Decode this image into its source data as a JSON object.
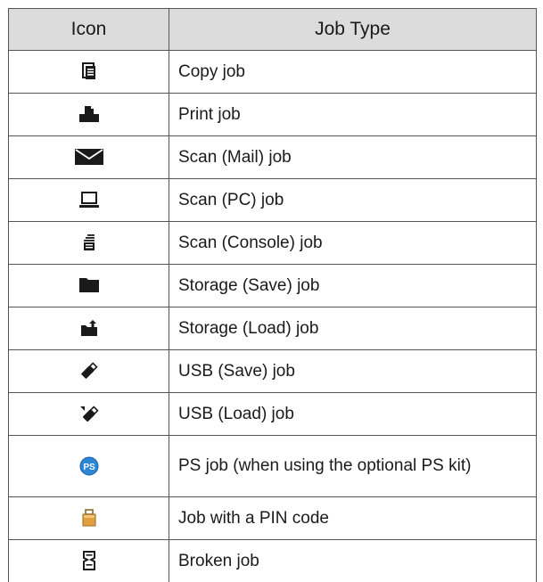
{
  "header": {
    "icon": "Icon",
    "job_type": "Job Type"
  },
  "rows": [
    {
      "icon": "copy-job-icon",
      "label": "Copy job"
    },
    {
      "icon": "print-job-icon",
      "label": "Print job"
    },
    {
      "icon": "mail-envelope-icon",
      "label": "Scan (Mail) job"
    },
    {
      "icon": "laptop-pc-icon",
      "label": "Scan (PC) job"
    },
    {
      "icon": "scan-console-icon",
      "label": "Scan (Console) job"
    },
    {
      "icon": "folder-icon",
      "label": "Storage (Save) job"
    },
    {
      "icon": "folder-load-icon",
      "label": "Storage (Load) job"
    },
    {
      "icon": "usb-save-icon",
      "label": "USB (Save) job"
    },
    {
      "icon": "usb-load-icon",
      "label": "USB (Load) job"
    },
    {
      "icon": "ps-icon",
      "label": "PS job (when using the optional PS kit)"
    },
    {
      "icon": "pin-lock-icon",
      "label": "Job with a PIN code"
    },
    {
      "icon": "broken-job-icon",
      "label": "Broken job"
    }
  ],
  "colors": {
    "header_bg": "#dcdcdc",
    "icon_dark": "#1a1a1a",
    "ps_blue": "#2b86d6",
    "pin_orange": "#e0a040"
  }
}
